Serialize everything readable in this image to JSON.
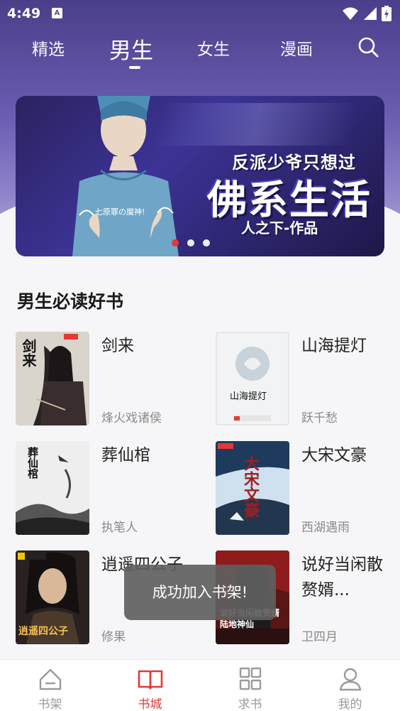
{
  "status_bar": {
    "time": "4:49",
    "notif_letter": "A"
  },
  "tabs": [
    {
      "label": "精选",
      "active": false
    },
    {
      "label": "男生",
      "active": true
    },
    {
      "label": "女生",
      "active": false
    },
    {
      "label": "漫画",
      "active": false
    }
  ],
  "banner": {
    "title_small": "反派少爷只想过",
    "title_big": "佛系生活",
    "author_line": "人之下-作品",
    "tagline": "七原罪の魔神!",
    "dots": 3,
    "active_dot": 0
  },
  "section": {
    "title": "男生必读好书",
    "books": [
      {
        "title": "剑来",
        "author": "烽火戏诸侯",
        "cover_text": "剑来"
      },
      {
        "title": "山海提灯",
        "author": "跃千愁",
        "cover_text": "山海提灯"
      },
      {
        "title": "葬仙棺",
        "author": "执笔人",
        "cover_text": "葬仙棺"
      },
      {
        "title": "大宋文豪",
        "author": "西湖遇雨",
        "cover_text": "大宋文豪"
      },
      {
        "title": "逍遥四公子",
        "author": "修果",
        "cover_text": "逍遥四公子"
      },
      {
        "title": "说好当闲散赘婿...",
        "author": "卫四月",
        "cover_text": "说好当闲散赘婿 陆地神仙"
      }
    ]
  },
  "toast": {
    "text": "成功加入书架!"
  },
  "bottom_nav": [
    {
      "label": "书架",
      "icon": "bookshelf-icon",
      "active": false
    },
    {
      "label": "书城",
      "icon": "bookstore-icon",
      "active": true
    },
    {
      "label": "求书",
      "icon": "grid-icon",
      "active": false
    },
    {
      "label": "我的",
      "icon": "profile-icon",
      "active": false
    }
  ],
  "colors": {
    "accent": "#e53935",
    "header_top": "#4a3f8a",
    "header_bottom": "#b8b1de"
  }
}
